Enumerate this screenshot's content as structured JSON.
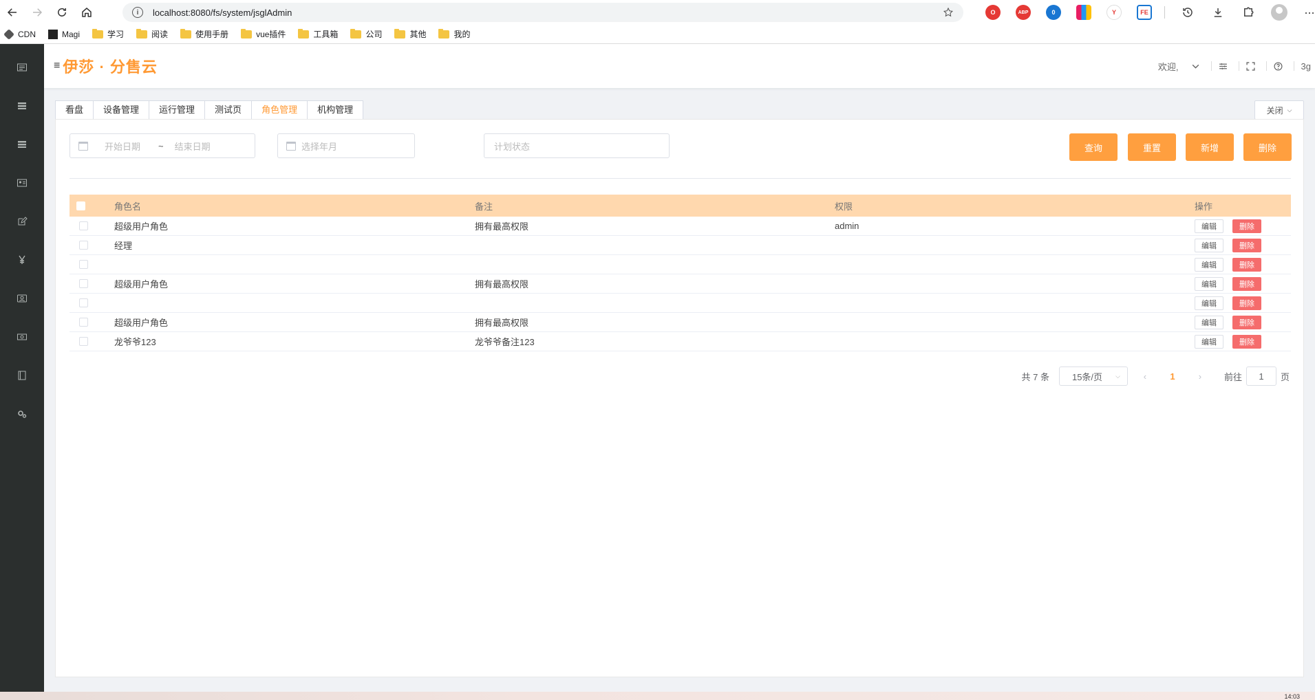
{
  "browser": {
    "url": "localhost:8080/fs/system/jsglAdmin",
    "bookmarks": [
      "CDN",
      "Magi",
      "学习",
      "阅读",
      "使用手册",
      "vue插件",
      "工具箱",
      "公司",
      "其他",
      "我的"
    ],
    "extensions": {
      "abp": "ABP",
      "badge": "0",
      "fe": "FE"
    }
  },
  "app": {
    "brand": "伊莎 · 分售云",
    "menu_icon": "≡",
    "welcome": "欢迎,",
    "user": "3g",
    "accent": "#ff9933"
  },
  "tabs": [
    {
      "label": "看盘"
    },
    {
      "label": "设备管理"
    },
    {
      "label": "运行管理"
    },
    {
      "label": "测试页"
    },
    {
      "label": "角色管理",
      "active": true
    },
    {
      "label": "机构管理"
    }
  ],
  "close_all": "关闭",
  "filters": {
    "start_placeholder": "开始日期",
    "range_sep": "~",
    "end_placeholder": "结束日期",
    "month_placeholder": "选择年月",
    "status_placeholder": "计划状态"
  },
  "buttons": {
    "query": "查询",
    "reset": "重置",
    "add": "新增",
    "delete": "删除"
  },
  "table": {
    "headers": {
      "name": "角色名",
      "note": "备注",
      "perm": "权限",
      "ops": "操作"
    },
    "rows": [
      {
        "name": "超级用户角色",
        "note": "拥有最高权限",
        "perm": "admin"
      },
      {
        "name": "经理",
        "note": "",
        "perm": ""
      },
      {
        "name": "",
        "note": "",
        "perm": ""
      },
      {
        "name": "超级用户角色",
        "note": "拥有最高权限",
        "perm": ""
      },
      {
        "name": "",
        "note": "",
        "perm": ""
      },
      {
        "name": "超级用户角色",
        "note": "拥有最高权限",
        "perm": ""
      },
      {
        "name": "龙爷爷123",
        "note": "龙爷爷备注123",
        "perm": ""
      }
    ],
    "edit_label": "编辑",
    "delete_label": "删除"
  },
  "pagination": {
    "total": "共 7 条",
    "page_size": "15条/页",
    "current": "1",
    "goto_label": "前往",
    "goto_value": "1",
    "goto_suffix": "页"
  },
  "taskbar": {
    "time": "14:03"
  }
}
